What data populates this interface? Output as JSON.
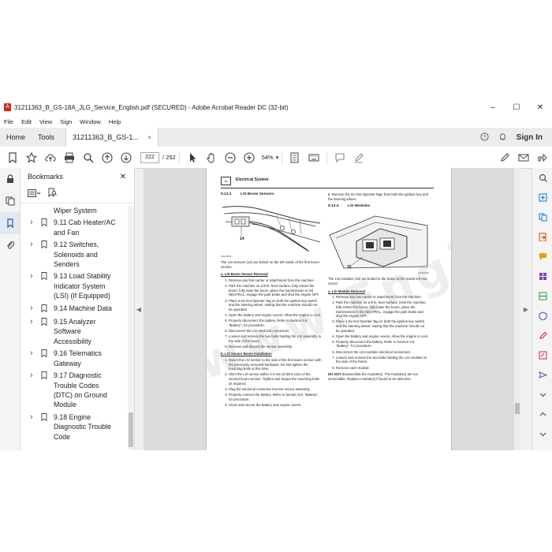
{
  "window": {
    "title": "31211363_B_GS-18A_JLG_Service_English.pdf (SECURED) - Adobe Acrobat Reader DC (32-bit)",
    "controls": {
      "minimize": "–",
      "maximize": "☐",
      "close": "✕"
    }
  },
  "menu": [
    "File",
    "Edit",
    "View",
    "Sign",
    "Window",
    "Help"
  ],
  "tabs": {
    "home": "Home",
    "tools": "Tools",
    "doc": "31211363_B_GS-1...",
    "close": "×",
    "signin": "Sign In"
  },
  "toolbar": {
    "page_current": "222",
    "page_total": "/ 252",
    "zoom": "54%"
  },
  "bookmarks": {
    "title": "Bookmarks",
    "items": [
      {
        "label": "Wiper System",
        "chevron": false
      },
      {
        "label": "9.11 Cab Heater/AC and Fan",
        "chevron": true
      },
      {
        "label": "9.12 Switches, Solenoids and Senders",
        "chevron": true
      },
      {
        "label": "9.13 Load Stability Indicator System (LSI) (If Equipped)",
        "chevron": true
      },
      {
        "label": "9.14 Machine Data",
        "chevron": true
      },
      {
        "label": "9.15 Analyzer Software Accessibility",
        "chevron": true
      },
      {
        "label": "9.16 Telematics Gateway",
        "chevron": true
      },
      {
        "label": "9.17 Diagnostic Trouble Codes (DTC) on Ground Module",
        "chevron": true
      },
      {
        "label": "9.18 Engine Diagnostic Trouble Code",
        "chevron": true
      }
    ]
  },
  "page": {
    "header": "Electrical System",
    "left": {
      "section_num": "9.13.3",
      "section_title": "LSI Boom Sensors",
      "fig_callout": "14",
      "fig_id": "MAM0551",
      "intro": "The LSI sensors (14) are bolted on the left inside of the first boom section.",
      "removal_title": "a.   LSI Boom Sensor Removal",
      "removal_steps": [
        "Remove any fork carrier or attachment from the machine.",
        "Park the machine on a firm, level surface, fully retract the boom, fully raise the boom, place the transmission in (N) NEUTRAL, engage the park brake and shut the engine OFF.",
        "Place a Do Not Operate Tag on both the ignition key switch and the steering wheel, stating that the machine should not be operated.",
        "Open the battery and engine covers. Allow the engine to cool.",
        "Properly disconnect the battery. Refer to Section 9.8, \"Battery\", for procedure.",
        "Disconnect the LSI electrical connectors.",
        "Loosen and remove the two bolts holding the LSI assembly to the side of the boom.",
        "Remove and discard the sensor assembly."
      ],
      "install_title": "b.   LSI Sensor Boom Installation",
      "install_steps": [
        "Mount the LSI sensor to the side of the first boom section with the previously removed hardware. Do Not tighten the mounting bolts at this time.",
        "Shim the LSI sensor within 2-3 mm (0.08-0.11in) of the second boom section. Tighten and torque the mounting bolts as required.",
        "Plug the electrical connector into the sensor assembly.",
        "Properly connect the battery. Refer to Section 9.8, \"Battery\", for procedure.",
        "Close and secure the battery and engine covers."
      ]
    },
    "right": {
      "top_step": "6.   Remove the Do Not Operate Tags from both the ignition key and the steering wheel.",
      "section_num": "9.13.4",
      "section_title": "LSI Modules",
      "fig_callout": "15",
      "fig_id": "MAM0552",
      "intro": "The LSI modules (15) are bolted to the frame at the inside left rear corner.",
      "removal_title": "a.   LSI Module Removal",
      "removal_steps": [
        "Remove any fork carrier or attachment from the machine.",
        "Park the machine on a firm, level surface, level the machine, fully retract the boom, fully lower the boom, place the transmission in (N) NEUTRAL, engage the park brake and shut the engine OFF.",
        "Place a Do Not Operate Tag on both the ignition key switch and the steering wheel, stating that the machine should not be operated.",
        "Open the battery and engine covers. Allow the engine to cool.",
        "Properly disconnect the battery. Refer to Section 9.8, \"Battery\", for procedure.",
        "Disconnect the LSI modules electrical connectors.",
        "Loosen and remove the two bolts holding the LSI modules to the side of the frame.",
        "Remove each module."
      ],
      "note_bold": "DO NOT",
      "note_text": " disassemble the module(s). The module(s) are not serviceable. Replace module(s) if found to be defective."
    },
    "watermark": "www.Engine-Repair.com"
  }
}
